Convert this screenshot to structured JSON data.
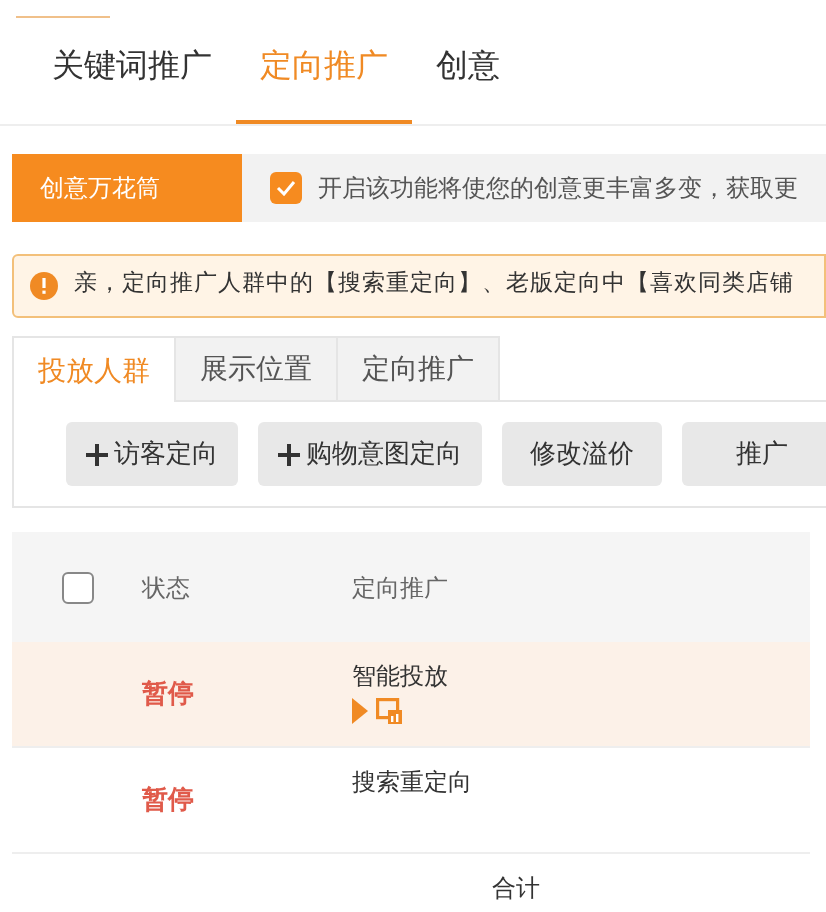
{
  "tabs": [
    {
      "label": "关键词推广",
      "selected": false
    },
    {
      "label": "定向推广",
      "selected": true
    },
    {
      "label": "创意",
      "selected": false
    }
  ],
  "kaleidoscope": {
    "label": "创意万花筒",
    "checked": true,
    "description": "开启该功能将使您的创意更丰富多变，获取更"
  },
  "notice": "亲，定向推广人群中的【搜索重定向】、老版定向中【喜欢同类店铺",
  "sub_tabs": [
    {
      "label": "投放人群",
      "selected": true
    },
    {
      "label": "展示位置",
      "selected": false
    },
    {
      "label": "定向推广",
      "selected": false
    }
  ],
  "actions": [
    {
      "label": "访客定向",
      "plus": true
    },
    {
      "label": "购物意图定向",
      "plus": true
    },
    {
      "label": "修改溢价",
      "plus": false
    },
    {
      "label": "推广",
      "plus": false
    }
  ],
  "table": {
    "select_all": false,
    "columns": [
      "状态",
      "定向推广"
    ],
    "rows": [
      {
        "status": "暂停",
        "name": "智能投放",
        "highlighted": true,
        "icons": true
      },
      {
        "status": "暂停",
        "name": "搜索重定向",
        "highlighted": false,
        "icons": false
      }
    ],
    "footer": "合计"
  }
}
